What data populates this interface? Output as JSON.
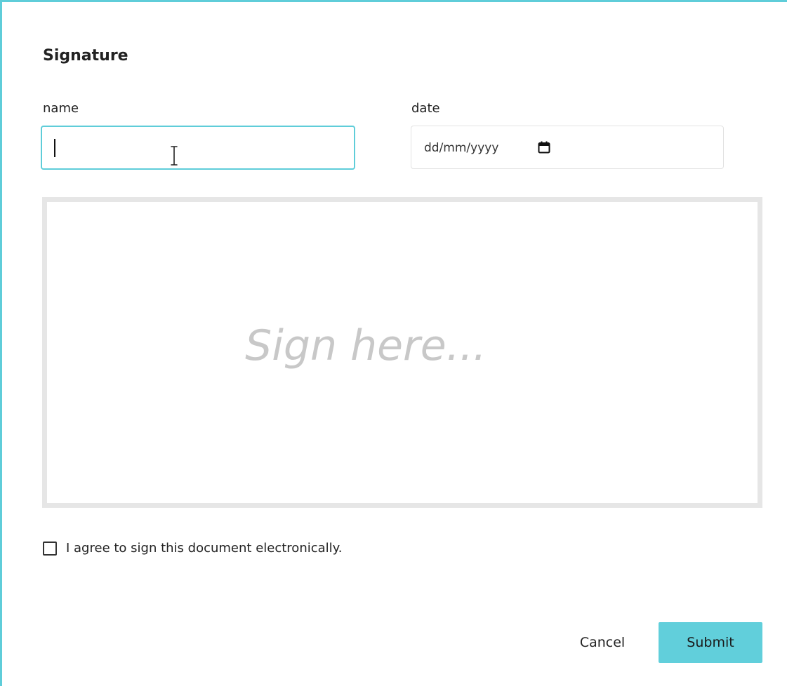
{
  "dialog": {
    "title": "Signature"
  },
  "form": {
    "name": {
      "label": "name",
      "value": ""
    },
    "date": {
      "label": "date",
      "placeholder": "dd/mm/yyyy",
      "icon": "calendar-icon"
    }
  },
  "signature_pad": {
    "placeholder": "Sign here..."
  },
  "consent": {
    "label": "I agree to sign this document electronically.",
    "checked": false
  },
  "actions": {
    "cancel_label": "Cancel",
    "submit_label": "Submit"
  },
  "colors": {
    "accent": "#5fcdd9",
    "submit_bg": "#61cfdb",
    "pad_border": "#e6e6e6",
    "placeholder_text": "#c8c8c8"
  }
}
